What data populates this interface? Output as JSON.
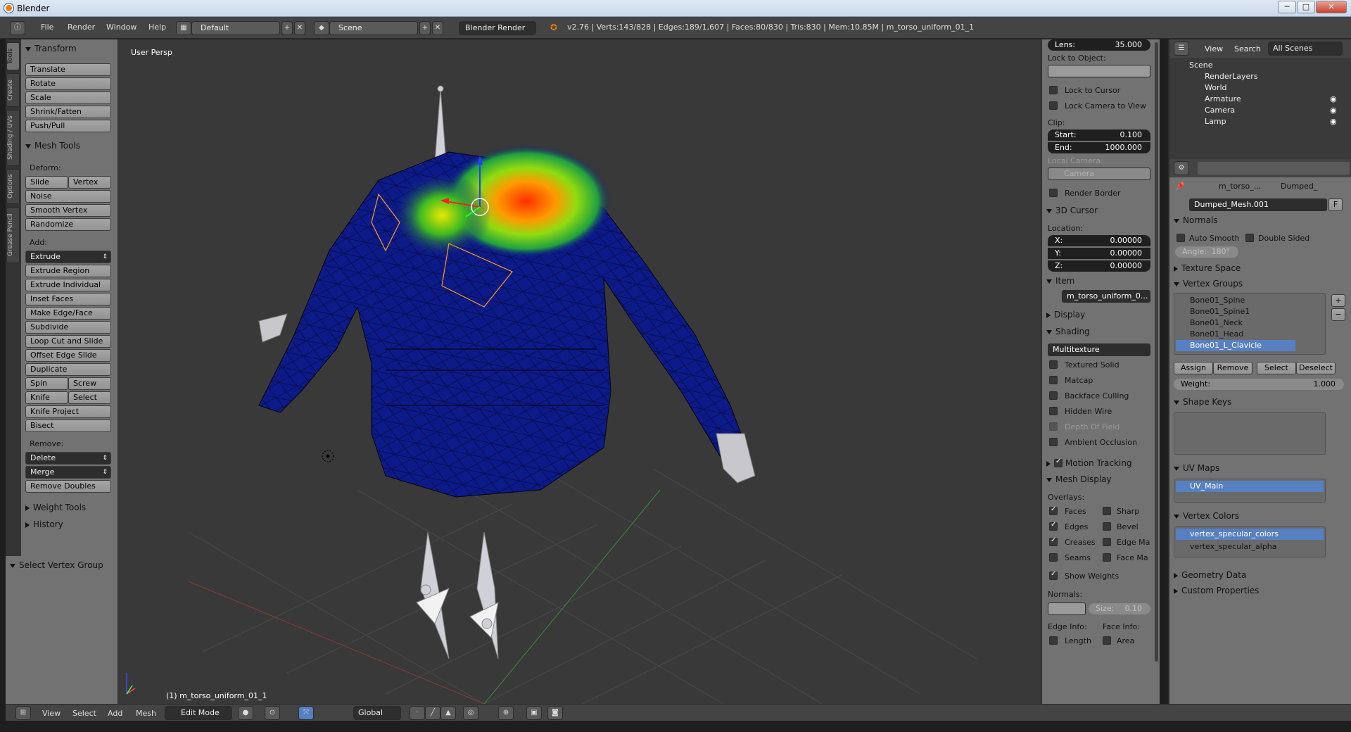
{
  "window": {
    "title": "Blender",
    "min_label": "─",
    "max_label": "□",
    "close_label": "✕"
  },
  "topbar": {
    "menus": [
      "File",
      "Render",
      "Window",
      "Help"
    ],
    "screen_layout": "Default",
    "scene": "Scene",
    "render_engine": "Blender Render",
    "stats": "v2.76 | Verts:143/828 | Edges:189/1,607 | Faces:80/830 | Tris:830 | Mem:10.85M | m_torso_uniform_01_1"
  },
  "tabs": [
    "Tools",
    "Create",
    "Shading / UVs",
    "Options",
    "Grease Pencil"
  ],
  "toolshelf": {
    "transform": {
      "title": "Transform",
      "buttons": [
        "Translate",
        "Rotate",
        "Scale",
        "Shrink/Fatten",
        "Push/Pull"
      ]
    },
    "mesh_tools": {
      "title": "Mesh Tools",
      "deform_label": "Deform:",
      "slide_edge": "Slide Edge",
      "vertex": "Vertex",
      "noise": "Noise",
      "smooth_vertex": "Smooth Vertex",
      "randomize": "Randomize",
      "add_label": "Add:",
      "extrude": "Extrude",
      "extrude_region": "Extrude Region",
      "extrude_individual": "Extrude Individual",
      "inset_faces": "Inset Faces",
      "make_edge_face": "Make Edge/Face",
      "subdivide": "Subdivide",
      "loop_cut": "Loop Cut and Slide",
      "offset_edge_slide": "Offset Edge Slide",
      "duplicate": "Duplicate",
      "spin": "Spin",
      "screw": "Screw",
      "knife": "Knife",
      "select": "Select",
      "knife_project": "Knife Project",
      "bisect": "Bisect",
      "remove_label": "Remove:",
      "delete": "Delete",
      "merge": "Merge",
      "remove_doubles": "Remove Doubles"
    },
    "weight_tools": "Weight Tools",
    "history": "History"
  },
  "redo_panel": {
    "title": "Select Vertex Group"
  },
  "viewport": {
    "label": "User Persp",
    "object": "(1) m_torso_uniform_01_1"
  },
  "npanel": {
    "lens_label": "Lens:",
    "lens_value": "35.000",
    "lock_to_object": "Lock to Object:",
    "lock_to_cursor": "Lock to Cursor",
    "lock_camera": "Lock Camera to View",
    "clip": "Clip:",
    "clip_start_label": "Start:",
    "clip_start": "0.100",
    "clip_end_label": "End:",
    "clip_end": "1000.000",
    "local_camera": "Local Camera:",
    "camera_placeholder": "Camera",
    "render_border": "Render Border",
    "cursor_title": "3D Cursor",
    "location": "Location:",
    "x_label": "X:",
    "x": "0.00000",
    "y_label": "Y:",
    "y": "0.00000",
    "z_label": "Z:",
    "z": "0.00000",
    "item_title": "Item",
    "item_name": "m_torso_uniform_0...",
    "display_title": "Display",
    "shading_title": "Shading",
    "shading_mode": "Multitexture",
    "textured_solid": "Textured Solid",
    "matcap": "Matcap",
    "backface": "Backface Culling",
    "hidden_wire": "Hidden Wire",
    "dof": "Depth Of Field",
    "ao": "Ambient Occlusion",
    "motion_tracking": "Motion Tracking",
    "mesh_display": "Mesh Display",
    "overlays": "Overlays:",
    "faces": "Faces",
    "sharp": "Sharp",
    "edges": "Edges",
    "bevel": "Bevel",
    "creases": "Creases",
    "edge_ma": "Edge Ma",
    "seams": "Seams",
    "face_ma": "Face Ma",
    "show_weights": "Show Weights",
    "normals": "Normals:",
    "size_label": "Size:",
    "size": "0.10",
    "edge_info": "Edge Info:",
    "face_info": "Face Info:",
    "length": "Length",
    "area": "Area"
  },
  "outliner": {
    "view": "View",
    "search": "Search",
    "filter": "All Scenes",
    "items": [
      "Scene",
      "RenderLayers",
      "World",
      "Armature",
      "Camera",
      "Lamp"
    ]
  },
  "properties": {
    "breadcrumb_obj": "m_torso_...",
    "breadcrumb_mesh": "Dumped_",
    "mesh_name": "Dumped_Mesh.001",
    "fake_user": "F",
    "normals_title": "Normals",
    "auto_smooth": "Auto Smooth",
    "double_sided": "Double Sided",
    "angle_label": "Angle:",
    "angle": "180°",
    "texture_space": "Texture Space",
    "vertex_groups_title": "Vertex Groups",
    "vertex_groups": [
      "Bone01_Spine",
      "Bone01_Spine1",
      "Bone01_Neck",
      "Bone01_Head",
      "Bone01_L_Clavicle"
    ],
    "assign": "Assign",
    "remove": "Remove",
    "select": "Select",
    "deselect": "Deselect",
    "weight_label": "Weight:",
    "weight": "1.000",
    "shape_keys": "Shape Keys",
    "uv_maps": "UV Maps",
    "uv_main": "UV_Main",
    "vertex_colors": "Vertex Colors",
    "vc1": "vertex_specular_colors",
    "vc2": "vertex_specular_alpha",
    "geometry_data": "Geometry Data",
    "custom_properties": "Custom Properties"
  },
  "bottombar": {
    "menus": [
      "View",
      "Select",
      "Add",
      "Mesh"
    ],
    "mode": "Edit Mode",
    "orientation": "Global"
  },
  "colors": {
    "selected": "#5680c2",
    "mesh_blue": "#0d1a8a",
    "accent_orange": "#e87d0d"
  }
}
